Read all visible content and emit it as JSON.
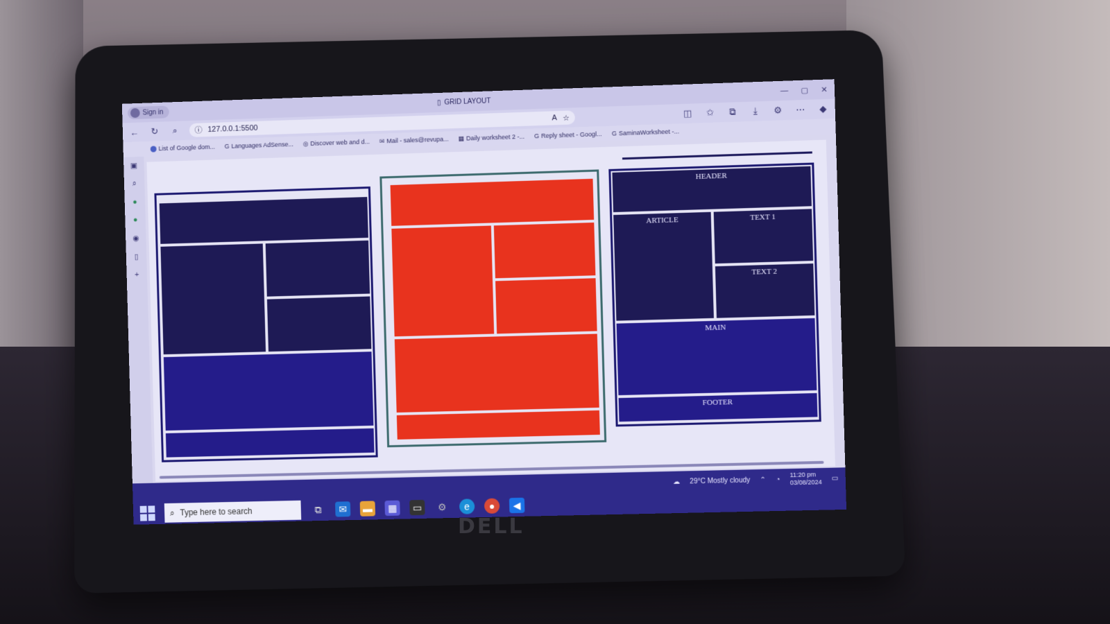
{
  "browser": {
    "signin_label": "Sign in",
    "tab_title": "GRID LAYOUT",
    "url": "127.0.0.1:5500",
    "bookmarks": [
      "List of Google dom...",
      "Languages AdSense...",
      "Discover web and d...",
      "Mail - sales@revupa...",
      "Daily worksheet 2 -...",
      "Reply sheet - Googl...",
      "SaminaWorksheet -..."
    ]
  },
  "layout": {
    "header": "HEADER",
    "article": "ARTICLE",
    "text1": "TEXT 1",
    "text2": "TEXT 2",
    "main": "MAIN",
    "footer": "FOOTER"
  },
  "colors": {
    "navy": "#1e1a55",
    "indigo": "#241c8a",
    "red": "#e8331e"
  },
  "taskbar": {
    "search_placeholder": "Type here to search",
    "weather": "29°C  Mostly cloudy",
    "time": "11:20 pm",
    "date": "03/08/2024"
  },
  "laptop": {
    "brand": "DELL"
  }
}
